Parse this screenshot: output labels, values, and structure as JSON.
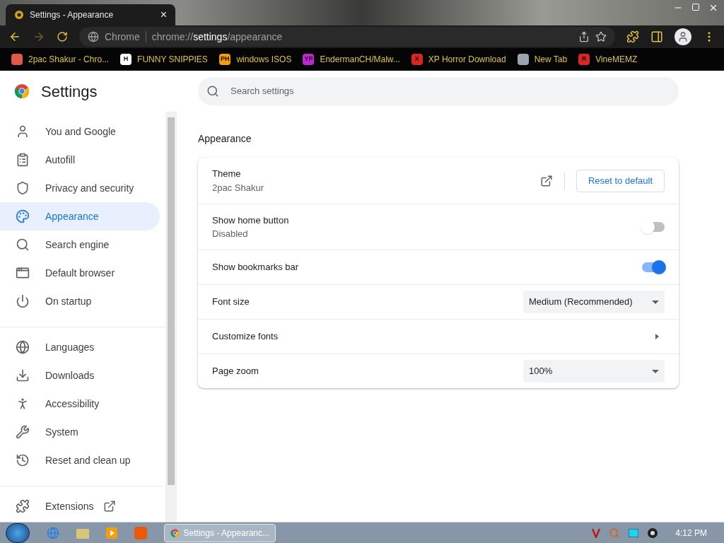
{
  "tab": {
    "title": "Settings - Appearance",
    "close": "×"
  },
  "toolbar": {
    "site_label": "Chrome",
    "url": {
      "scheme": "chrome://",
      "host": "settings",
      "path": "/appearance"
    }
  },
  "bookmarks": [
    {
      "label": "2pac Shakur - Chro...",
      "color": "#e05a4a"
    },
    {
      "label": "FUNNY SNIPPIES",
      "color": "#ffffff",
      "mark": "H"
    },
    {
      "label": "windows ISOS",
      "color": "#f59e0b",
      "mark": "PH"
    },
    {
      "label": "EndermanCH/Malw...",
      "color": "#c026d3",
      "mark": "YP"
    },
    {
      "label": "XP Horror Download",
      "color": "#dc2626",
      "mark": "X"
    },
    {
      "label": "New Tab",
      "color": "#9ca3af"
    },
    {
      "label": "VineMEMZ",
      "color": "#dc2626",
      "mark": "R"
    }
  ],
  "app": {
    "title": "Settings",
    "search_placeholder": "Search settings"
  },
  "sidebar": [
    [
      {
        "label": "You and Google",
        "selected": false
      },
      {
        "label": "Autofill",
        "selected": false
      },
      {
        "label": "Privacy and security",
        "selected": false
      },
      {
        "label": "Appearance",
        "selected": true
      },
      {
        "label": "Search engine",
        "selected": false
      },
      {
        "label": "Default browser",
        "selected": false
      },
      {
        "label": "On startup",
        "selected": false
      }
    ],
    [
      {
        "label": "Languages",
        "selected": false
      },
      {
        "label": "Downloads",
        "selected": false
      },
      {
        "label": "Accessibility",
        "selected": false
      },
      {
        "label": "System",
        "selected": false
      },
      {
        "label": "Reset and clean up",
        "selected": false
      }
    ],
    [
      {
        "label": "Extensions",
        "selected": false
      }
    ]
  ],
  "section": {
    "title": "Appearance",
    "rows": [
      {
        "kind": "theme",
        "label": "Theme",
        "sublabel": "2pac Shakur",
        "button": "Reset to default"
      },
      {
        "kind": "toggle",
        "label": "Show home button",
        "sublabel": "Disabled",
        "on": false
      },
      {
        "kind": "toggle",
        "label": "Show bookmarks bar",
        "on": true
      },
      {
        "kind": "select",
        "label": "Font size",
        "value": "Medium (Recommended)"
      },
      {
        "kind": "submenu",
        "label": "Customize fonts"
      },
      {
        "kind": "select",
        "label": "Page zoom",
        "value": "100%"
      }
    ]
  },
  "taskbar": {
    "window": "Settings - Appearanc...",
    "time": "4:12 PM"
  }
}
